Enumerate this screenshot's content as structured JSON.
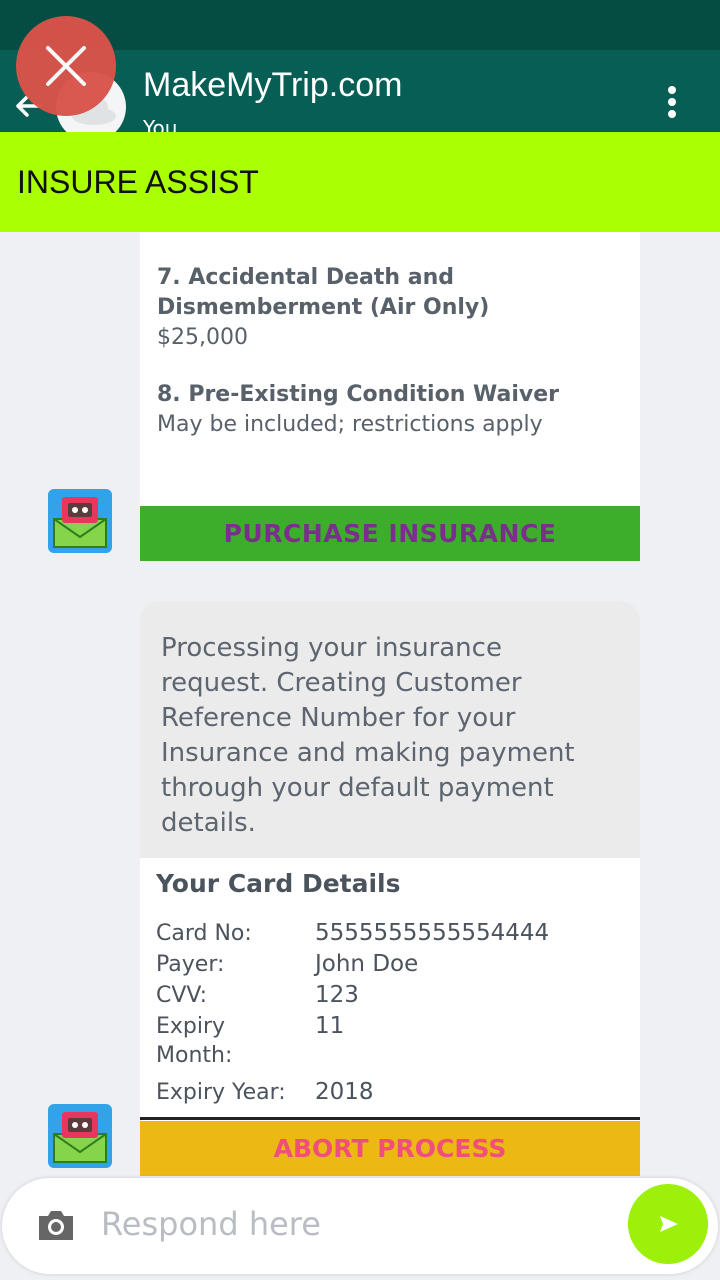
{
  "header": {
    "title": "MakeMyTrip.com",
    "subtitle": "You"
  },
  "banner": {
    "label": "INSURE ASSIST"
  },
  "coverage": [
    {
      "heading": "7. Accidental Death and",
      "heading2": "Dismemberment (Air Only)",
      "detail": "$25,000"
    },
    {
      "heading": "8. Pre-Existing Condition Waiver",
      "detail": "May be included; restrictions apply"
    }
  ],
  "purchase_button": "PURCHASE INSURANCE",
  "message": {
    "lines": [
      "Processing your insurance",
      "request. Creating Customer",
      "Reference Number for your",
      "Insurance and making payment",
      "through your default payment",
      "details."
    ]
  },
  "card_details": {
    "heading": "Your Card Details",
    "card_no_label": "Card No:",
    "card_no": "5555555555554444",
    "payer_label": "Payer:",
    "payer": "John Doe",
    "cvv_label": "CVV:",
    "cvv": "123",
    "expiry_month_label_1": "Expiry",
    "expiry_month_label_2": "Month:",
    "expiry_month": "11",
    "expiry_year_label": "Expiry Year:",
    "expiry_year": "2018"
  },
  "abort_button": "ABORT PROCESS",
  "composer": {
    "placeholder": "Respond here"
  },
  "colors": {
    "appbar": "#075e54",
    "banner": "#aaff00",
    "purchase": "#3dae2b",
    "abort": "#ecb813",
    "send": "#9cf00a",
    "close": "#d9534a"
  }
}
